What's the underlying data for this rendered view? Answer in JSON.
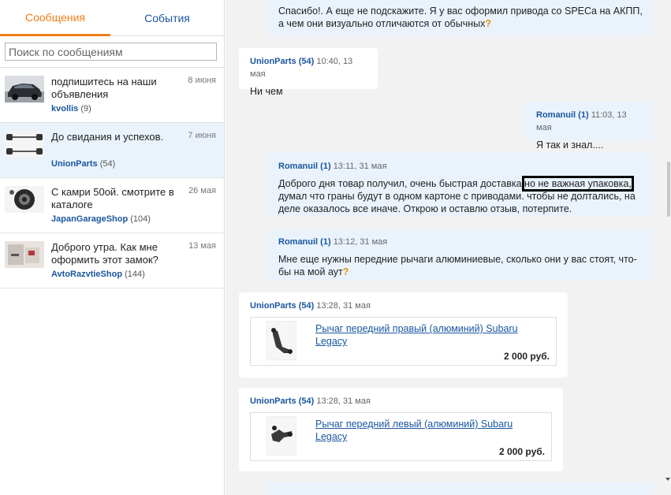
{
  "tabs": {
    "messages": "Сообщения",
    "events": "События"
  },
  "search": {
    "placeholder": "Поиск по сообщениям"
  },
  "conversations": [
    {
      "text": "подпишитесь на наши объявления",
      "date": "8 июня",
      "name": "kvollis",
      "count": "(9)",
      "active": false
    },
    {
      "text": "До свидания и успехов.",
      "date": "7 июня",
      "name": "UnionParts",
      "count": "(54)",
      "active": true
    },
    {
      "text": "С камри 50ой. смотрите в каталоге",
      "date": "26 мая",
      "name": "JapanGarageShop",
      "count": "(104)",
      "active": false
    },
    {
      "text": "Доброго утра. Как мне оформить этот замок?",
      "date": "13 мая",
      "name": "AvtoRazvtieShop",
      "count": "(144)",
      "active": false
    }
  ],
  "messages": [
    {
      "text": "Спасибо!. А еще не подскажите. Я у вас оформил привода со SPECа на АКПП, а чем они визуально отличаются от обычных",
      "qmark": "?"
    },
    {
      "author": "UnionParts (54)",
      "time": "10:40, 13 мая",
      "text": "Ни чем"
    },
    {
      "author": "Romanuil (1)",
      "time": "11:03, 13 мая",
      "text": "Я так и знал...."
    },
    {
      "author": "Romanuil (1)",
      "time": "13:11, 31 мая",
      "text_before": "Доброго дня товар получил, очень быстрая доставка ",
      "text_highlight": "но не важная упаковка,",
      "text_after": " думал что граны будут в одном картоне с приводами. чтобы не долтались, на деле оказалось все иначе. Открою и оставлю отзыв, потерпите."
    },
    {
      "author": "Romanuil (1)",
      "time": "13:12, 31 мая",
      "text": "Мне еще нужны передние рычаги алюминиевые, сколько они у вас стоят, что-бы на мой аут",
      "qmark": "?"
    },
    {
      "author": "UnionParts (54)",
      "time": "13:28, 31 мая",
      "product_title": "Рычаг передний правый (алюминий) Subaru Legacy",
      "product_price": "2 000 руб."
    },
    {
      "author": "UnionParts (54)",
      "time": "13:28, 31 мая",
      "product_title": "Рычаг передний левый (алюминий) Subaru Legacy",
      "product_price": "2 000 руб."
    }
  ]
}
